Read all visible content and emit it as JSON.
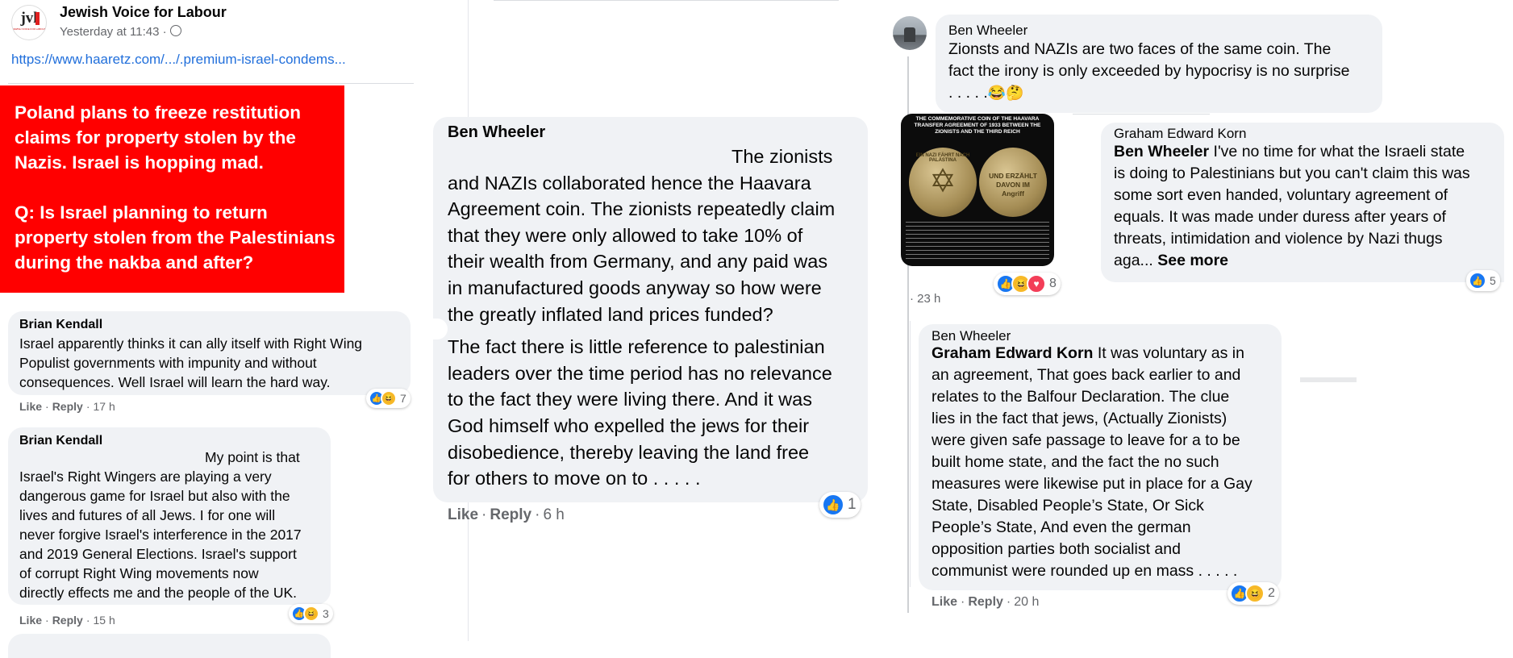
{
  "post": {
    "page_name": "Jewish Voice for Labour",
    "logo_text": "jvl",
    "logo_subtext": "JEWISH VOICE FOR LABOUR",
    "timestamp": "Yesterday at 11:43 ·",
    "link": "https://www.haaretz.com/.../.premium-israel-condems...",
    "image_line1": "Poland plans to freeze restitution",
    "image_line2": "claims for property stolen by the",
    "image_line3": "Nazis. Israel is hopping mad.",
    "image_line4": "Q: Is Israel planning to return",
    "image_line5": "property stolen from the Palestinians",
    "image_line6": "during the nakba and after?",
    "image_bg": "#ff0000"
  },
  "left_comments": [
    {
      "author": "Brian Kendall",
      "lines": [
        "Israel apparently thinks it can ally itself with Right Wing",
        "Populist governments with impunity and without",
        "consequences. Well Israel will learn the hard way."
      ],
      "like": "Like",
      "reply": "Reply",
      "time": "17 h",
      "reactions": "7"
    },
    {
      "author": "Brian Kendall",
      "lines": [
        "My point is that",
        "Israel's Right Wingers are playing a very",
        "dangerous game for Israel but also with the",
        "lives and futures of all Jews. I for one will",
        "never forgive Israel's interference in the 2017",
        "and 2019 General Elections. Israel's support",
        "of corrupt Right Wing movements now",
        "directly effects me and the people of the UK."
      ],
      "like": "Like",
      "reply": "Reply",
      "time": "15 h",
      "reactions": "3"
    }
  ],
  "middle_comment": {
    "author": "Ben Wheeler",
    "lines": [
      "The zionists",
      "and NAZIs collaborated hence the Haavara",
      "Agreement coin. The zionists repeatedly claim",
      "that they were only allowed to take 10% of",
      "their wealth from Germany, and any paid was",
      "in manufactured goods anyway so how were",
      "the greatly inflated land prices funded?"
    ],
    "lines2": [
      "The fact there is little reference to palestinian",
      "leaders over the time period has no relevance",
      "to the fact they were living there. And it was",
      "God himself who expelled the jews for their",
      "disobedience, thereby leaving the land free",
      "for others to move on to . . . . ."
    ],
    "like": "Like",
    "reply": "Reply",
    "time": "6 h",
    "reactions": "1"
  },
  "right_top": {
    "author": "Ben Wheeler",
    "lines": [
      "Zionsts and NAZIs are two faces of the same coin. The",
      "fact the irony is only exceeded by hypocrisy is no surprise",
      ". . . . ."
    ],
    "coin_caption_top1": "THE COMMEMORATIVE COIN OF THE HAAVARA",
    "coin_caption_top2": "TRANSFER AGREEMENT OF 1933 BETWEEN THE",
    "coin_caption_top3": "ZIONISTS AND THE THIRD REICH",
    "coin_left_text": "EIN NAZI FÄHRT NACH PALÄSTINA",
    "coin_right_text": "UND ERZÄHLT DAVON IM Angriff",
    "coin_reactions": "8",
    "time": "23 h"
  },
  "right_reply": {
    "author": "Graham Edward Korn",
    "mention": "Ben Wheeler",
    "lines_first": " I've no time for what the Israeli state",
    "lines": [
      "is doing to Palestinians but you can't claim this was",
      "some sort even handed, voluntary agreement of",
      "equals. It was made under duress after years of",
      "threats, intimidation and violence by Nazi thugs"
    ],
    "truncated": "aga...",
    "see_more": "See more",
    "reactions": "5"
  },
  "right_bottom": {
    "author": "Ben Wheeler",
    "mention": "Graham Edward Korn",
    "lines_first": " It was voluntary as in",
    "lines": [
      "an agreement, That goes back earlier to and",
      "relates to the Balfour Declaration. The clue",
      "lies in the fact that jews, (Actually Zionists)",
      "were given safe passage to leave for a to be",
      "built home state, and the fact the no such",
      "measures were likewise put in place for a Gay",
      "State, Disabled People’s State, Or Sick",
      "People’s State, And even the german",
      "opposition parties both socialist and",
      "communist were rounded up en mass . . . . ."
    ],
    "like": "Like",
    "reply": "Reply",
    "time": "20 h",
    "reactions": "2"
  }
}
